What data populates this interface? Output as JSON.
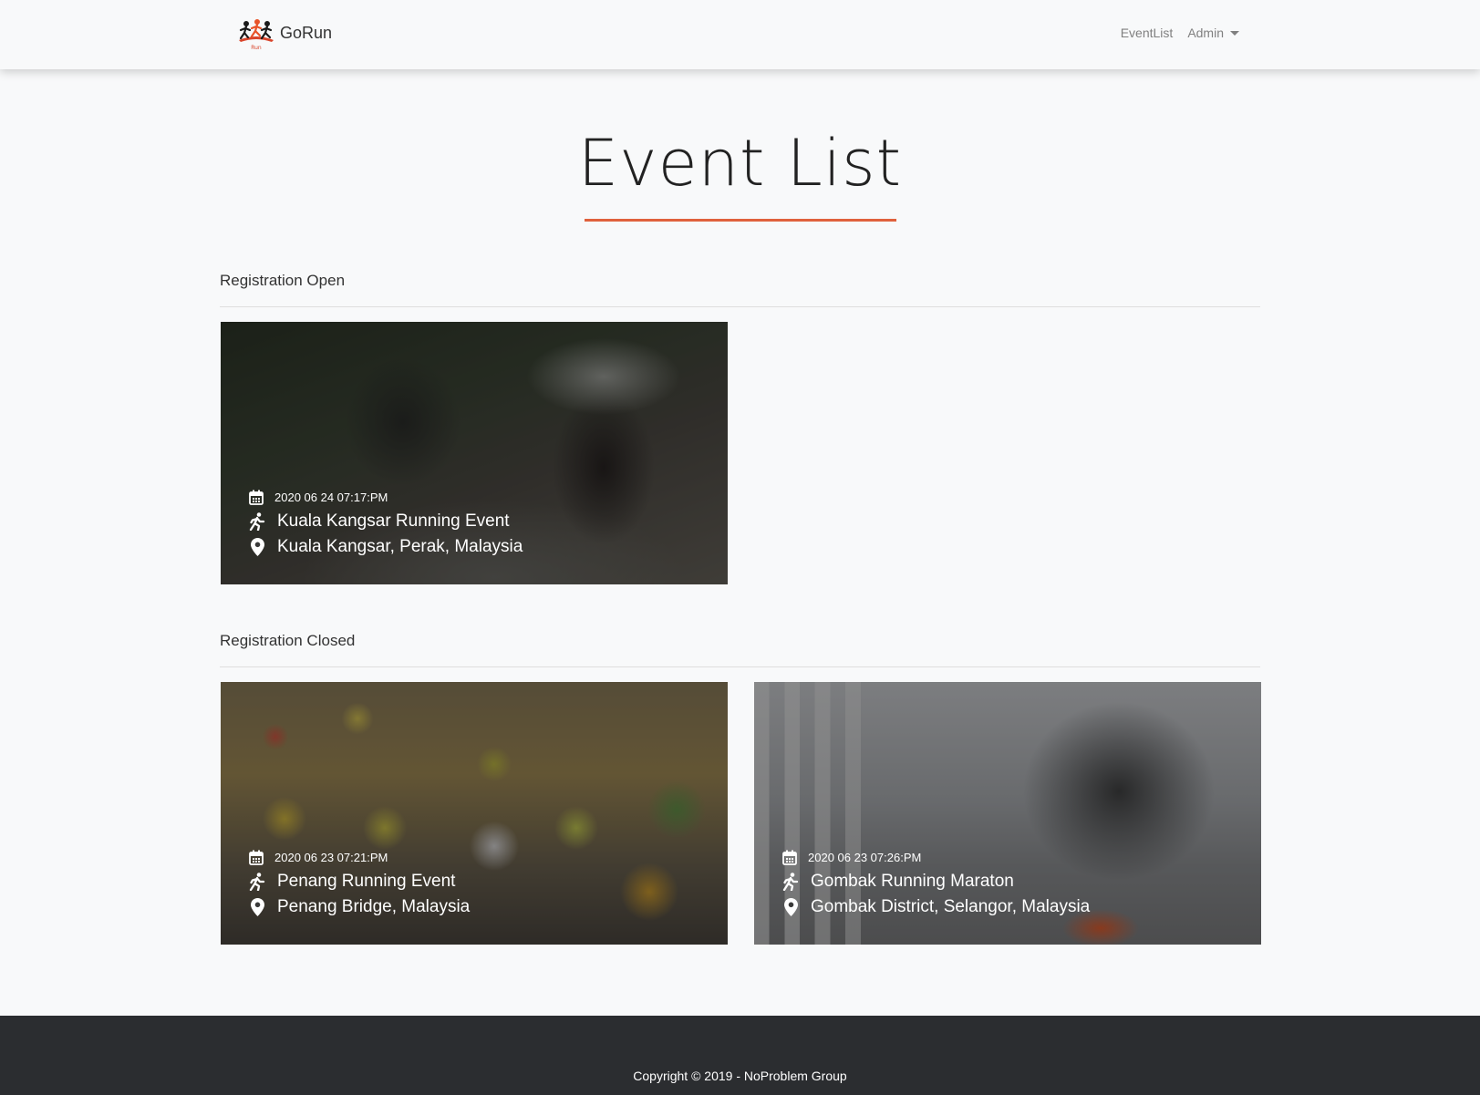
{
  "nav": {
    "brand": "GoRun",
    "logo_caption": "Run",
    "links": {
      "event_list": "EventList",
      "admin": "Admin"
    }
  },
  "page": {
    "title": "Event List"
  },
  "sections": {
    "open": {
      "heading": "Registration Open",
      "events": [
        {
          "datetime": "2020 06 24 07:17:PM",
          "name": "Kuala Kangsar Running Event",
          "location": "Kuala Kangsar, Perak, Malaysia"
        }
      ]
    },
    "closed": {
      "heading": "Registration Closed",
      "events": [
        {
          "datetime": "2020 06 23 07:21:PM",
          "name": "Penang Running Event",
          "location": "Penang Bridge, Malaysia"
        },
        {
          "datetime": "2020 06 23 07:26:PM",
          "name": "Gombak Running Maraton",
          "location": "Gombak District, Selangor, Malaysia"
        }
      ]
    }
  },
  "footer": {
    "copyright": "Copyright © 2019 - NoProblem Group"
  },
  "colors": {
    "accent": "#e0613c",
    "footer_bg": "#2b2d30",
    "page_bg": "#f8f9fa"
  },
  "icons": {
    "date": "calendar-icon",
    "name": "runner-icon",
    "location": "map-pin-icon"
  }
}
